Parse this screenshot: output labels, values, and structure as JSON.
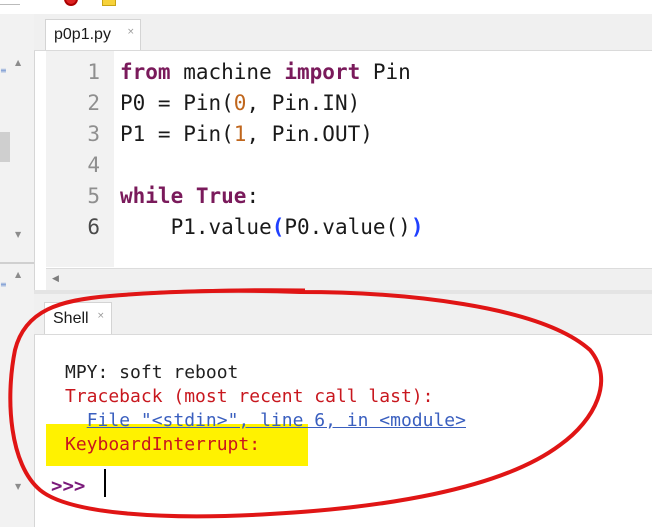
{
  "editor": {
    "tab_label": "p0p1.py",
    "tab_close": "×",
    "line_numbers": [
      "1",
      "2",
      "3",
      "4",
      "5",
      "6"
    ],
    "code": {
      "l1_kw1": "from",
      "l1_mid": " machine ",
      "l1_kw2": "import",
      "l1_end": " Pin",
      "l2_a": "P0 = Pin(",
      "l2_num": "0",
      "l2_b": ", Pin.IN)",
      "l3_a": "P1 = Pin(",
      "l3_num": "1",
      "l3_b": ", Pin.OUT)",
      "l5_kw1": "while",
      "l5_sp": " ",
      "l5_kw2": "True",
      "l5_end": ":",
      "l6_a": "    P1.value",
      "l6_open": "(",
      "l6_mid": "P0.value()",
      "l6_close": ")"
    }
  },
  "shell": {
    "tab_label": "Shell",
    "tab_close": "×",
    "line1": "MPY: soft reboot",
    "line2": "Traceback (most recent call last):",
    "line3_indent": "  ",
    "line3": "File \"<stdin>\", line 6, in <module>",
    "line4": "KeyboardInterrupt:",
    "prompt": ">>>"
  },
  "colors": {
    "keyword": "#7a1a5b",
    "number": "#c0661c",
    "error_red": "#c8171e",
    "highlight": "#fff200",
    "annotation": "#e01515"
  }
}
